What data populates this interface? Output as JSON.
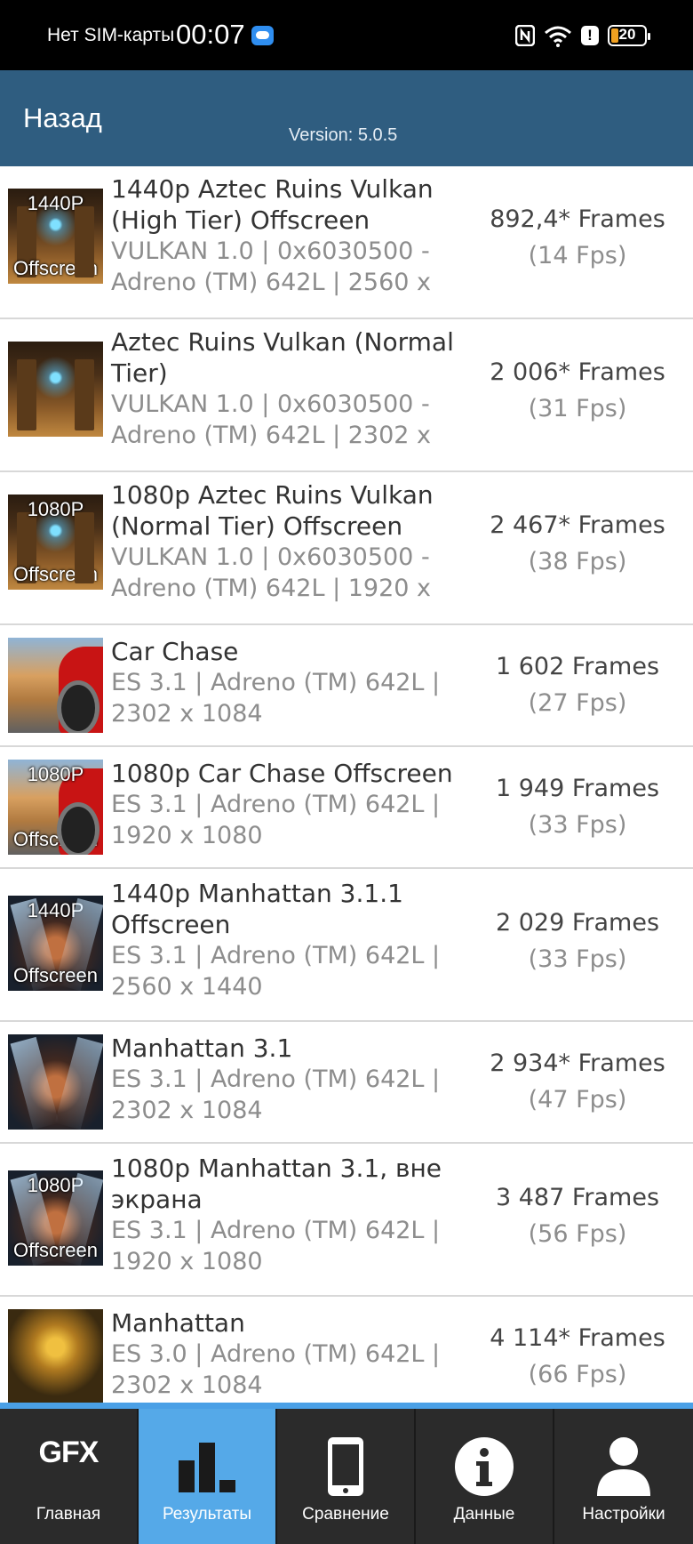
{
  "status_bar": {
    "carrier": "Нет SIM-карты",
    "time": "00:07",
    "battery": "20",
    "icons": [
      "cloud-icon",
      "nfc-icon",
      "wifi-icon",
      "alert-icon",
      "battery-icon"
    ]
  },
  "header": {
    "back_label": "Назад",
    "version": "Version: 5.0.5"
  },
  "results": [
    {
      "title": "1440p Aztec Ruins Vulkan (High Tier) Offscreen",
      "details": "VULKAN 1.0 | 0x6030500 - Adreno (TM) 642L | 2560 x",
      "frames": "892,4* Frames",
      "fps": "(14 Fps)",
      "thumb_top": "1440P",
      "thumb_bottom": "Offscreen"
    },
    {
      "title": "Aztec Ruins Vulkan (Normal Tier)",
      "details": "VULKAN 1.0 | 0x6030500 - Adreno (TM) 642L | 2302 x",
      "frames": "2 006* Frames",
      "fps": "(31 Fps)",
      "thumb_top": "",
      "thumb_bottom": ""
    },
    {
      "title": "1080p Aztec Ruins Vulkan (Normal Tier) Offscreen",
      "details": "VULKAN 1.0 | 0x6030500 - Adreno (TM) 642L | 1920 x",
      "frames": "2 467* Frames",
      "fps": "(38 Fps)",
      "thumb_top": "1080P",
      "thumb_bottom": "Offscreen"
    },
    {
      "title": "Car Chase",
      "details": "ES 3.1 | Adreno (TM) 642L | 2302 x 1084",
      "frames": "1 602 Frames",
      "fps": "(27 Fps)",
      "thumb_top": "",
      "thumb_bottom": ""
    },
    {
      "title": "1080p Car Chase Offscreen",
      "details": "ES 3.1 | Adreno (TM) 642L | 1920 x 1080",
      "frames": "1 949 Frames",
      "fps": "(33 Fps)",
      "thumb_top": "1080P",
      "thumb_bottom": "Offscreen"
    },
    {
      "title": "1440p Manhattan 3.1.1 Offscreen",
      "details": "ES 3.1 | Adreno (TM) 642L | 2560 x 1440",
      "frames": "2 029 Frames",
      "fps": "(33 Fps)",
      "thumb_top": "1440P",
      "thumb_bottom": "Offscreen"
    },
    {
      "title": "Manhattan 3.1",
      "details": "ES 3.1 | Adreno (TM) 642L | 2302 x 1084",
      "frames": "2 934* Frames",
      "fps": "(47 Fps)",
      "thumb_top": "",
      "thumb_bottom": ""
    },
    {
      "title": "1080p Manhattan 3.1, вне экрана",
      "details": "ES 3.1 | Adreno (TM) 642L | 1920 x 1080",
      "frames": "3 487 Frames",
      "fps": "(56 Fps)",
      "thumb_top": "1080P",
      "thumb_bottom": "Offscreen"
    },
    {
      "title": "Manhattan",
      "details": "ES 3.0 | Adreno (TM) 642L | 2302 x 1084",
      "frames": "4 114* Frames",
      "fps": "(66 Fps)",
      "thumb_top": "",
      "thumb_bottom": ""
    }
  ],
  "bottom_nav": {
    "logo": "GFX",
    "tabs": [
      {
        "label": "Главная",
        "icon": "gfx-logo-icon",
        "active": false
      },
      {
        "label": "Результаты",
        "icon": "bar-chart-icon",
        "active": true
      },
      {
        "label": "Сравнение",
        "icon": "phone-icon",
        "active": false
      },
      {
        "label": "Данные",
        "icon": "info-icon",
        "active": false
      },
      {
        "label": "Настройки",
        "icon": "person-icon",
        "active": false
      }
    ]
  },
  "colors": {
    "header_bg": "#2f5d80",
    "nav_bg": "#2b2b2b",
    "nav_active": "#55a9e8"
  }
}
